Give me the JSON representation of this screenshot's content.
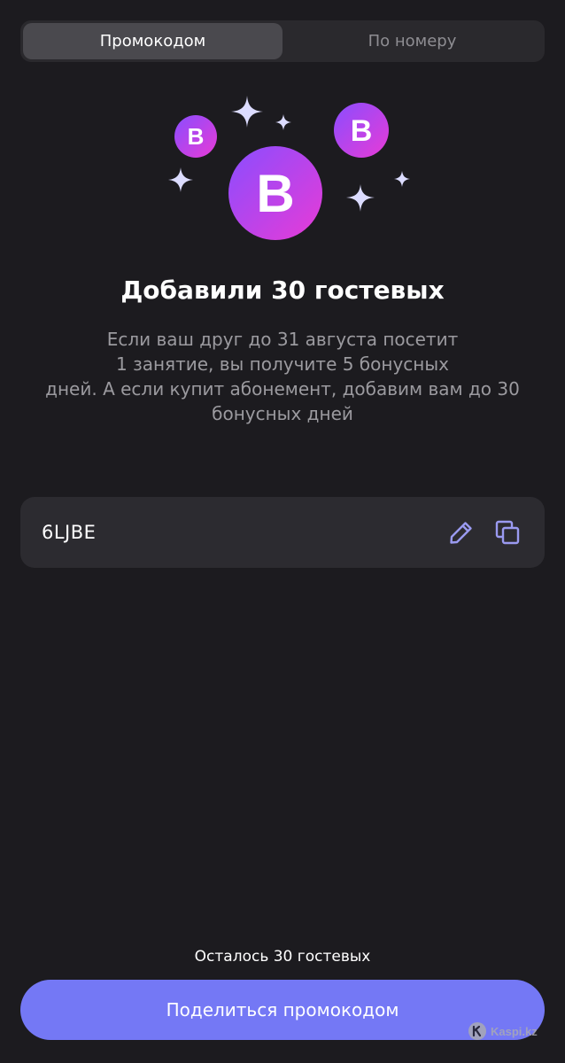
{
  "tabs": [
    {
      "label": "Промокодом",
      "active": true
    },
    {
      "label": "По номеру",
      "active": false
    }
  ],
  "illustration": {
    "badge_letter": "B",
    "icon": "bonus-coins-illustration"
  },
  "title": "Добавили 30 гостевых",
  "description": {
    "lines": [
      "Если ваш друг до 31 августа посетит",
      "1 занятие, вы получите 5 бонусных",
      "дней. А если купит абонемент, добавим вам до 30",
      "бонусных дней"
    ]
  },
  "promo": {
    "code": "6LJBE",
    "edit_icon": "pencil-icon",
    "copy_icon": "copy-icon"
  },
  "remaining": "Осталось 30 гостевых",
  "share_button": "Поделиться промокодом",
  "watermark": "Kaspi.kz",
  "colors": {
    "background": "#1c1b1f",
    "accent": "#7478f5",
    "badge_gradient_start": "#8a4dff",
    "badge_gradient_end": "#e83bd6",
    "sparkle": "#dcdcff",
    "icon_tint": "#9a9af0"
  }
}
